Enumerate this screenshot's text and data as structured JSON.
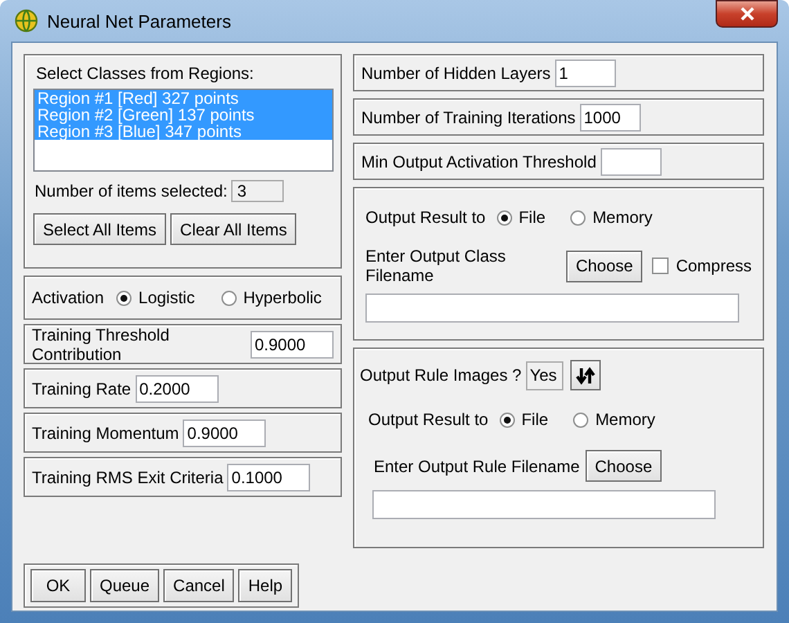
{
  "window": {
    "title": "Neural Net Parameters"
  },
  "classes": {
    "label": "Select Classes from Regions:",
    "items": [
      {
        "text": "Region #1 [Red] 327 points",
        "selected": true
      },
      {
        "text": "Region #2 [Green] 137 points",
        "selected": true
      },
      {
        "text": "Region #3 [Blue] 347 points",
        "selected": true
      }
    ],
    "count_label": "Number of items selected:",
    "count_value": "3",
    "buttons": [
      "Select All Items",
      "Clear All Items"
    ]
  },
  "activation": {
    "label": "Activation",
    "options": [
      {
        "label": "Logistic",
        "selected": true
      },
      {
        "label": "Hyperbolic",
        "selected": false
      }
    ]
  },
  "training": [
    {
      "label": "Training Threshold Contribution",
      "value": "0.9000"
    },
    {
      "label": "Training Rate",
      "value": "0.2000"
    },
    {
      "label": "Training Momentum",
      "value": "0.9000"
    },
    {
      "label": "Training RMS Exit Criteria",
      "value": "0.1000"
    }
  ],
  "network": [
    {
      "label": "Number of Hidden Layers",
      "value": "1"
    },
    {
      "label": "Number of Training Iterations",
      "value": "1000"
    },
    {
      "label": "Min Output Activation Threshold"
    }
  ],
  "output_class": {
    "output_label": "Output Result to",
    "options": [
      {
        "label": "File",
        "selected": true
      },
      {
        "label": "Memory",
        "selected": false
      }
    ],
    "filename_label": "Enter Output Class Filename",
    "choose_button": "Choose",
    "compress": {
      "label": "Compress",
      "checked": false
    }
  },
  "output_rule": {
    "label": "Output Rule Images ?",
    "value": "Yes",
    "output_label": "Output Result to",
    "options": [
      {
        "label": "File",
        "selected": true
      },
      {
        "label": "Memory",
        "selected": false
      }
    ],
    "filename_label": "Enter Output Rule Filename",
    "choose_button": "Choose"
  },
  "buttons": [
    "OK",
    "Queue",
    "Cancel",
    "Help"
  ]
}
